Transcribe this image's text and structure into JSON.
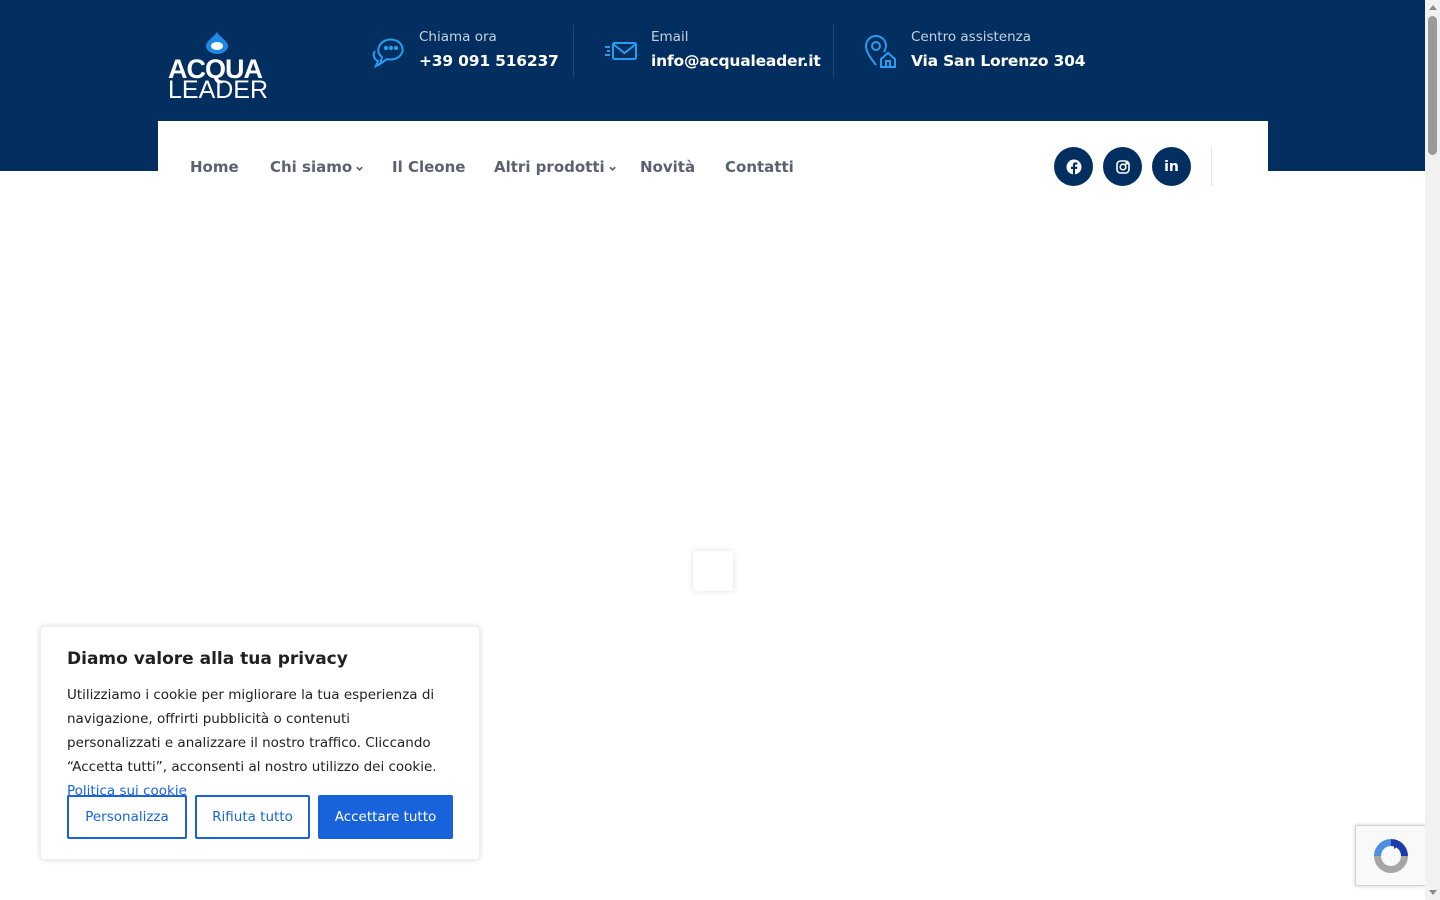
{
  "brand": {
    "logo_line1": "ACQUA",
    "logo_line2": "LEADER",
    "primary_color": "#022f5f",
    "accent_color": "#1e88e5"
  },
  "header": {
    "contacts": [
      {
        "icon": "chat-bubble-icon",
        "label": "Chiama ora",
        "value": "+39 091 516237"
      },
      {
        "icon": "envelope-icon",
        "label": "Email",
        "value": "info@acqualeader.it"
      },
      {
        "icon": "location-home-icon",
        "label": "Centro assistenza",
        "value": "Via San Lorenzo 304"
      }
    ]
  },
  "nav": {
    "items": [
      {
        "label": "Home",
        "has_dropdown": false
      },
      {
        "label": "Chi siamo",
        "has_dropdown": true
      },
      {
        "label": "Il Cleone",
        "has_dropdown": false
      },
      {
        "label": "Altri prodotti",
        "has_dropdown": true
      },
      {
        "label": "Novità",
        "has_dropdown": false
      },
      {
        "label": "Contatti",
        "has_dropdown": false
      }
    ],
    "social": [
      {
        "icon": "facebook-icon"
      },
      {
        "icon": "instagram-icon"
      },
      {
        "icon": "linkedin-icon",
        "text": "in"
      }
    ]
  },
  "cookie_banner": {
    "title": "Diamo valore alla tua privacy",
    "body": "Utilizziamo i cookie per migliorare la tua esperienza di navigazione, offrirti pubblicità o contenuti personalizzati e analizzare il nostro traffico. Cliccando “Accetta tutti”, acconsenti al nostro utilizzo dei cookie.",
    "policy_link": "Politica sui cookie",
    "buttons": {
      "customize": "Personalizza",
      "reject": "Rifiuta tutto",
      "accept": "Accettare tutto"
    },
    "button_color": "#1863dc"
  }
}
